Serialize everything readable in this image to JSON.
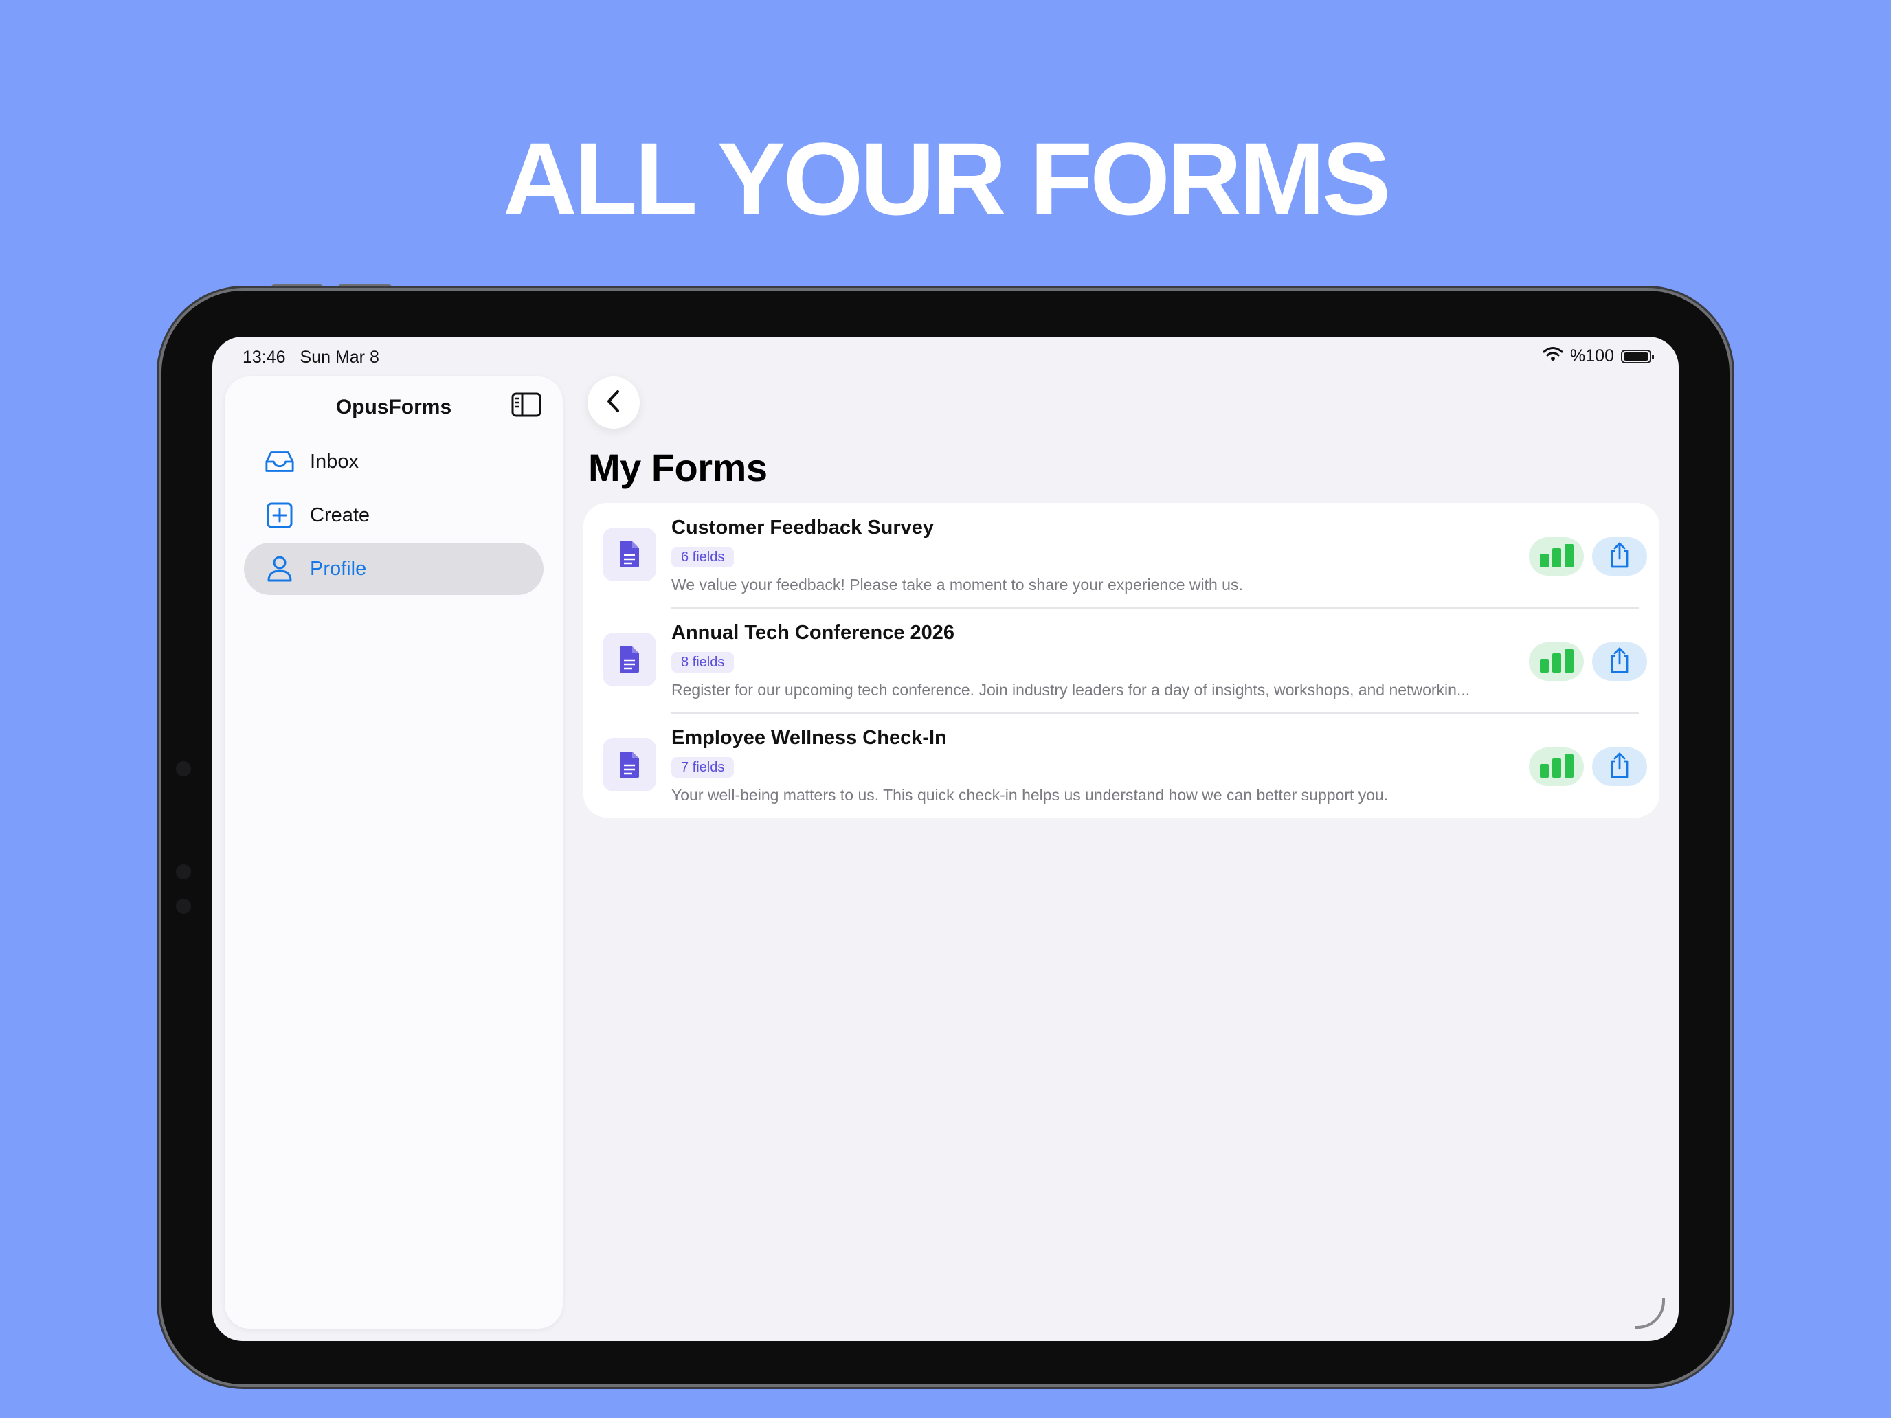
{
  "headline": "ALL YOUR FORMS",
  "status_bar": {
    "time": "13:46",
    "date": "Sun Mar 8",
    "battery": "%100"
  },
  "sidebar": {
    "title": "OpusForms",
    "items": [
      {
        "label": "Inbox",
        "icon": "tray-icon",
        "active": false
      },
      {
        "label": "Create",
        "icon": "plus-square-icon",
        "active": false
      },
      {
        "label": "Profile",
        "icon": "person-icon",
        "active": true
      }
    ]
  },
  "main": {
    "title": "My Forms",
    "forms": [
      {
        "name": "Customer Feedback Survey",
        "fields": "6 fields",
        "description": "We value your feedback! Please take a moment to share your experience with us."
      },
      {
        "name": "Annual Tech Conference 2026",
        "fields": "8 fields",
        "description": "Register for our upcoming tech conference. Join industry leaders for a day of insights, workshops, and networkin..."
      },
      {
        "name": "Employee Wellness Check-In",
        "fields": "7 fields",
        "description": "Your well-being matters to us. This quick check-in helps us understand how we can better support you."
      }
    ]
  },
  "colors": {
    "background": "#7d9ffb",
    "accent_blue": "#1677e6",
    "accent_purple": "#5b4fdc",
    "accent_green": "#29c04c"
  }
}
